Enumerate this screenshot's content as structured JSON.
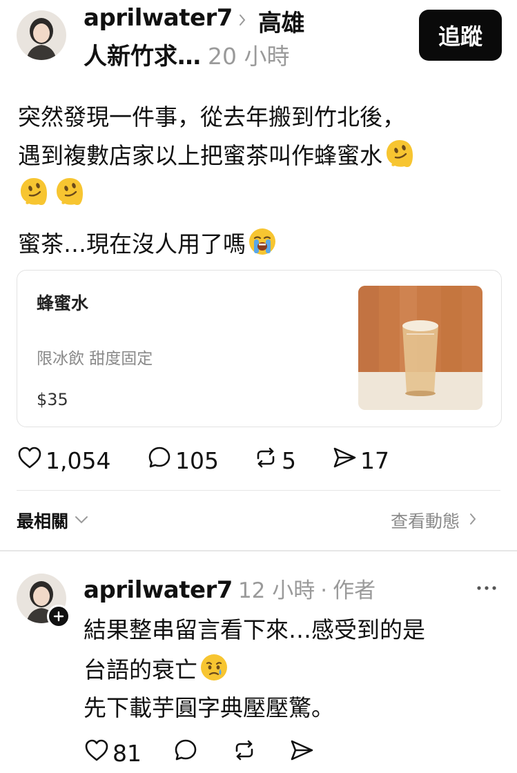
{
  "post": {
    "username": "aprilwater7",
    "location": "高雄",
    "topic": "人新竹求…",
    "time": "20 小時",
    "follow_label": "追蹤",
    "lines": [
      "突然發現一件事，從去年搬到竹北後，",
      "遇到複數店家以上把蜜茶叫作蜂蜜水",
      "",
      "蜜茶…現在沒人用了嗎"
    ],
    "emojis": {
      "melting": "melting-face",
      "crying": "loudly-crying-face"
    },
    "product_card": {
      "name": "蜂蜜水",
      "note": "限冰飲 甜度固定",
      "price": "$35"
    },
    "actions": {
      "likes": "1,054",
      "comments": "105",
      "reposts": "5",
      "shares": "17"
    }
  },
  "sort_bar": {
    "sort_label": "最相關",
    "activity_label": "查看動態"
  },
  "reply": {
    "username": "aprilwater7",
    "time": "12 小時",
    "separator": "·",
    "author_tag": "作者",
    "more": "···",
    "lines": [
      "結果整串留言看下來…感受到的是",
      "台語的衰亡",
      "先下載芋圓字典壓壓驚。"
    ],
    "actions": {
      "likes": "81"
    }
  },
  "colors": {
    "follow_bg": "#0a0a0a",
    "meta_grey": "#9a9a9a",
    "emoji_yellow": "#f7c531"
  }
}
